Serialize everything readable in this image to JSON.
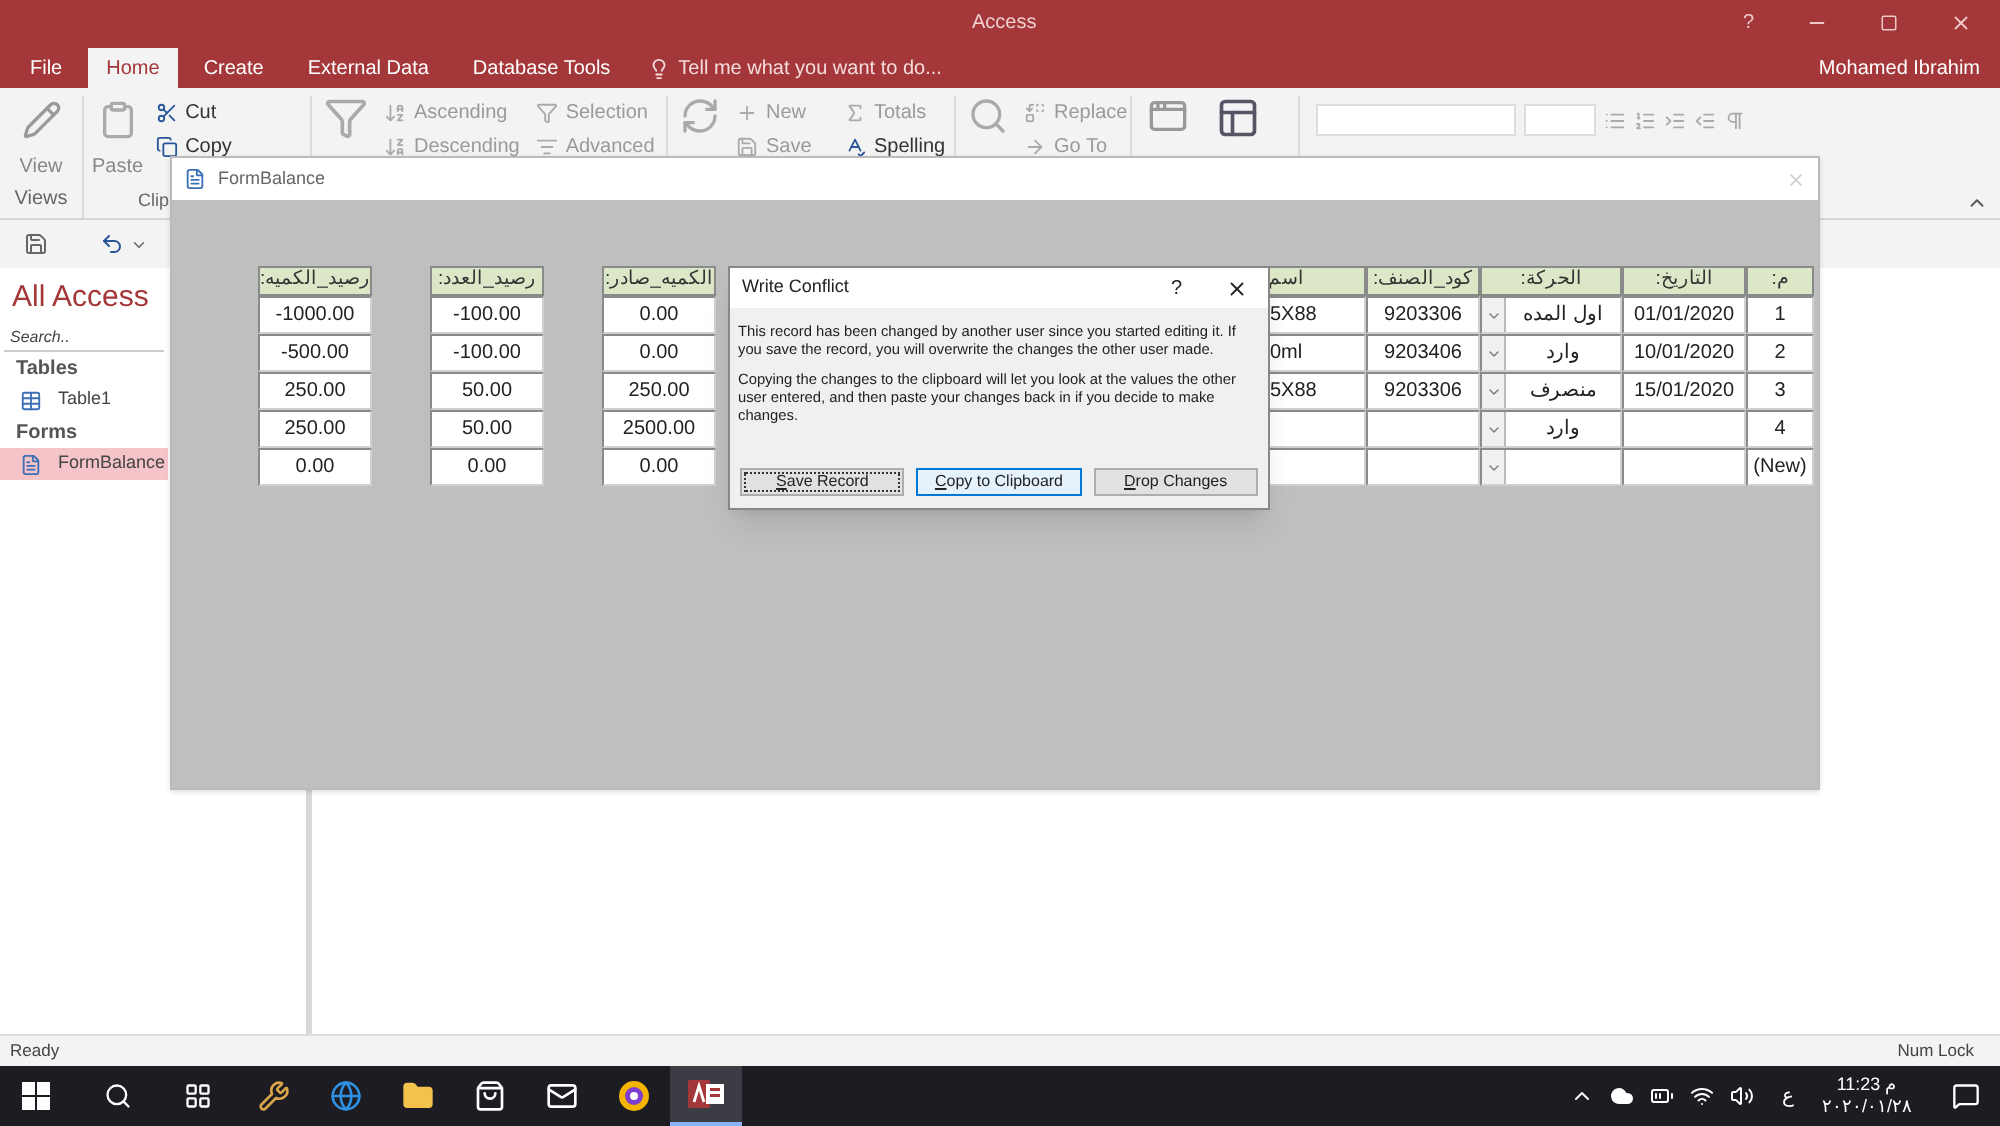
{
  "window": {
    "title": "Access",
    "help": "?",
    "user": "Mohamed Ibrahim"
  },
  "ribbon_tabs": [
    {
      "label": "File",
      "selected": false
    },
    {
      "label": "Home",
      "selected": true
    },
    {
      "label": "Create",
      "selected": false
    },
    {
      "label": "External Data",
      "selected": false
    },
    {
      "label": "Database Tools",
      "selected": false
    }
  ],
  "tell_me": "Tell me what you want to do...",
  "ribbon": {
    "view": "View",
    "paste": "Paste",
    "groups": [
      "Views",
      "Clip"
    ],
    "commands": [
      {
        "label": "Cut",
        "disabled": false
      },
      {
        "label": "Copy",
        "disabled": false
      },
      {
        "label": "Ascending",
        "disabled": true
      },
      {
        "label": "Descending",
        "disabled": true
      },
      {
        "label": "Selection",
        "disabled": true
      },
      {
        "label": "Advanced",
        "disabled": true
      },
      {
        "label": "New",
        "disabled": true
      },
      {
        "label": "Save",
        "disabled": true
      },
      {
        "label": "Totals",
        "disabled": true
      },
      {
        "label": "Spelling",
        "disabled": false
      },
      {
        "label": "Replace",
        "disabled": true
      },
      {
        "label": "Go To",
        "disabled": true
      }
    ]
  },
  "nav_pane": {
    "title": "All Access",
    "search_placeholder": "Search..",
    "sections": [
      {
        "title": "Tables",
        "items": [
          {
            "label": "Table1",
            "kind": "table",
            "selected": false
          }
        ]
      },
      {
        "title": "Forms",
        "items": [
          {
            "label": "FormBalance",
            "kind": "form",
            "selected": true
          }
        ]
      }
    ]
  },
  "form": {
    "title": "FormBalance",
    "field_columns": [
      {
        "header": "الكميه_صادر:",
        "cells": [
          "0.00",
          "0.00",
          "250.00",
          "2500.00",
          "0.00"
        ]
      },
      {
        "header": "رصيد_العدد:",
        "cells": [
          "-100.00",
          "-100.00",
          "50.00",
          "50.00",
          "0.00"
        ]
      },
      {
        "header": "رصيد_الكميه:",
        "cells": [
          "-1000.00",
          "-500.00",
          "250.00",
          "250.00",
          "0.00"
        ]
      }
    ],
    "grid_columns": [
      {
        "header": "م:",
        "kind": "index",
        "cells": [
          "1",
          "2",
          "3",
          "4",
          "(New)"
        ]
      },
      {
        "header": "التاريخ:",
        "kind": "date",
        "cells": [
          "01/01/2020",
          "10/01/2020",
          "15/01/2020",
          null,
          null
        ]
      },
      {
        "header": "الحركة:",
        "kind": "combo",
        "cells": [
          "اول المده",
          "وارد",
          "منصرف",
          "وارد",
          null
        ]
      },
      {
        "header": "كود_الصنف:",
        "kind": "code",
        "cells": [
          "9203306",
          "9203406",
          "9203306",
          null,
          null
        ]
      },
      {
        "header": "اسم",
        "kind": "cut",
        "cells": [
          "5X88",
          "0ml",
          "5X88",
          null,
          null
        ]
      }
    ]
  },
  "dialog": {
    "title": "Write Conflict",
    "help": "?",
    "paragraphs": [
      "This record has been changed by another user since you started editing it.  If you save the record, you will overwrite the changes the other user made.",
      "Copying the changes to the clipboard will let you look at the values the other user entered, and then paste your changes back in if you decide to make changes."
    ],
    "buttons": [
      {
        "label": "Save Record",
        "focused": true,
        "default": false
      },
      {
        "label": "Copy to Clipboard",
        "focused": false,
        "default": true
      },
      {
        "label": "Drop Changes",
        "focused": false,
        "default": false
      }
    ]
  },
  "status_bar": {
    "left": "Ready",
    "right": "Num Lock"
  },
  "taskbar": {
    "apps": [
      {
        "active": false
      },
      {
        "active": false
      },
      {
        "active": false
      },
      {
        "active": false
      },
      {
        "active": false
      },
      {
        "active": false
      },
      {
        "active": true
      }
    ],
    "ime": "ع",
    "time": "11:23 م",
    "date": "٢٠٢٠/٠١/٢٨"
  }
}
